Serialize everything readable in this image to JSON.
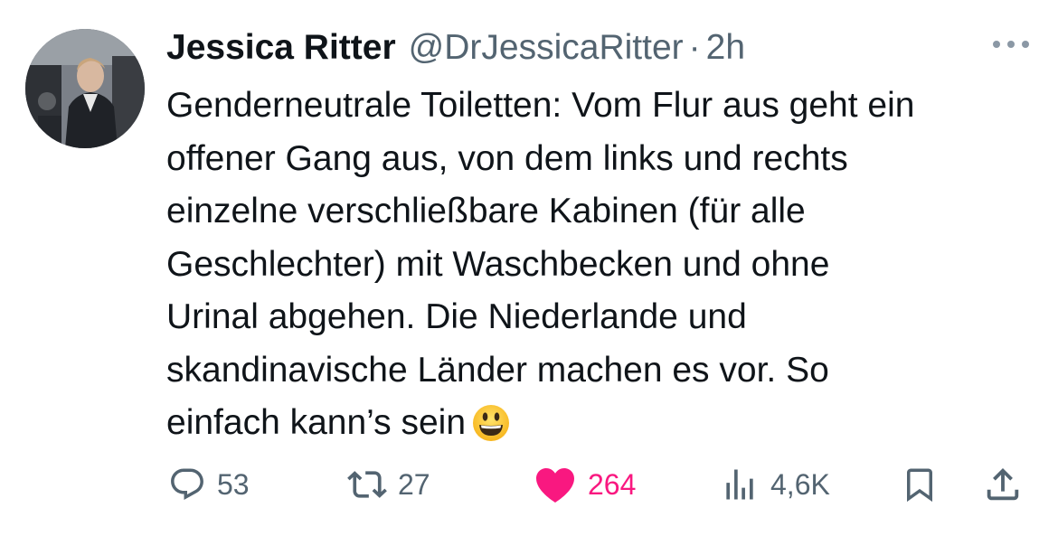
{
  "colors": {
    "text": "#0f1419",
    "secondary": "#536471",
    "like": "#f91880"
  },
  "author": {
    "display_name": "Jessica Ritter",
    "handle": "@DrJessicaRitter",
    "separator": "·",
    "timestamp": "2h",
    "avatar_icon": "profile-photo"
  },
  "tweet": {
    "lines": [
      "Genderneutrale Toiletten: Vom Flur aus geht ein",
      "offener Gang aus, von dem links und rechts",
      "einzelne verschließbare Kabinen (für alle",
      "Geschlechter) mit Waschbecken und ohne",
      "Urinal abgehen. Die Niederlande und",
      "skandinavische Länder machen es vor. So",
      "einfach kann’s sein"
    ],
    "emoji": "grinning-face-emoji"
  },
  "actions": {
    "reply": {
      "icon": "reply-icon",
      "count": "53"
    },
    "retweet": {
      "icon": "retweet-icon",
      "count": "27"
    },
    "like": {
      "icon": "heart-icon",
      "count": "264",
      "liked": true
    },
    "views": {
      "icon": "views-icon",
      "count": "4,6K"
    },
    "bookmark": {
      "icon": "bookmark-icon"
    },
    "share": {
      "icon": "share-icon"
    }
  },
  "menu": {
    "icon": "more-options-icon"
  }
}
